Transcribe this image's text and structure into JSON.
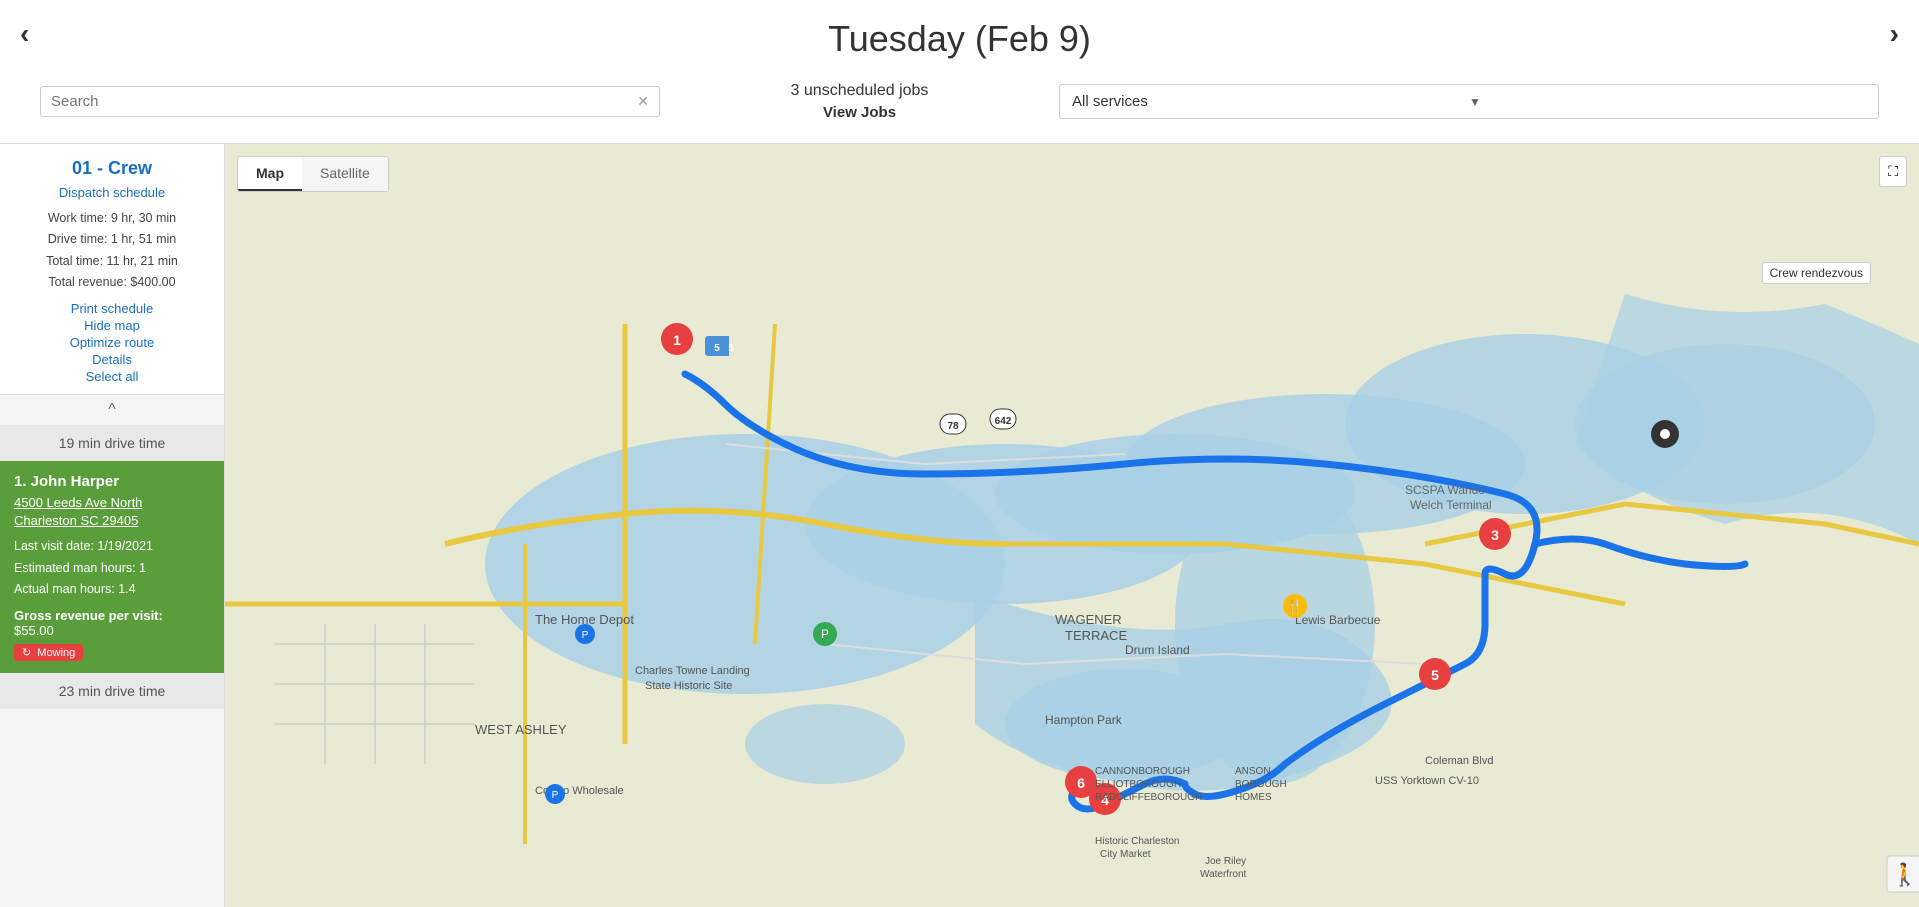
{
  "header": {
    "title": "Tuesday (Feb 9)",
    "nav_left": "‹",
    "nav_right": "›"
  },
  "toolbar": {
    "search_placeholder": "Search",
    "search_clear": "✕",
    "unscheduled_jobs": "3 unscheduled jobs",
    "view_jobs": "View Jobs",
    "services_label": "All services",
    "services_chevron": "▼"
  },
  "left_panel": {
    "crew_title": "01 - Crew",
    "dispatch_link": "Dispatch schedule",
    "work_time": "Work time: 9 hr, 30 min",
    "drive_time": "Drive time: 1 hr, 51 min",
    "total_time": "Total time: 11 hr, 21 min",
    "total_revenue": "Total revenue: $400.00",
    "print_schedule": "Print schedule",
    "hide_map": "Hide map",
    "optimize_route": "Optimize route",
    "details": "Details",
    "select_all": "Select all",
    "collapse_icon": "^",
    "drive_time_1": "19 min drive time",
    "job_1": {
      "number": "1. John Harper",
      "address_line1": "4500 Leeds Ave North",
      "address_line2": "Charleston SC 29405",
      "last_visit": "Last visit date: 1/19/2021",
      "estimated_hours": "Estimated man hours: 1",
      "actual_hours": "Actual man hours: 1.4",
      "gross_revenue_label": "Gross revenue per visit:",
      "gross_revenue": "$55.00",
      "service": "Mowing",
      "service_icon": "↻"
    },
    "drive_time_2": "23 min drive time"
  },
  "map": {
    "tab_map": "Map",
    "tab_satellite": "Satellite",
    "fullscreen_icon": "⛶",
    "crew_rendezvous": "Crew rendezvous"
  }
}
